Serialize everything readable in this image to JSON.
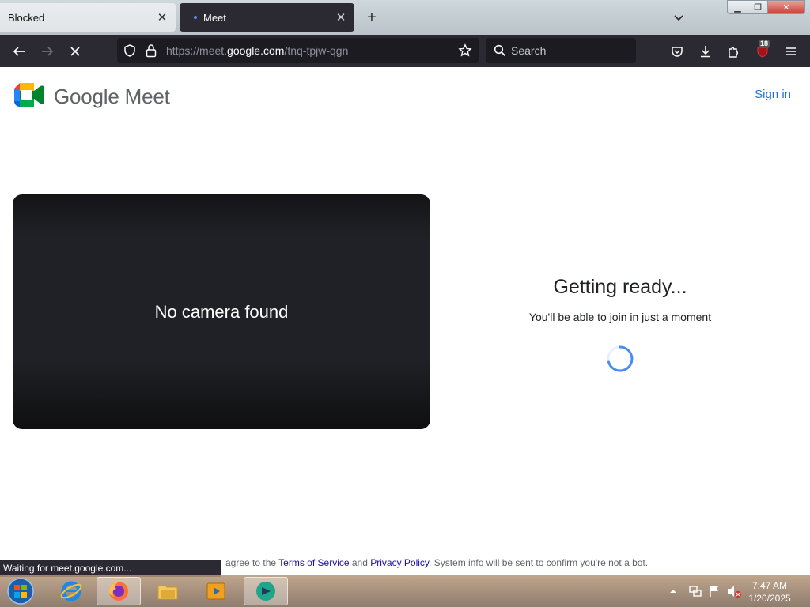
{
  "browser": {
    "tabs": [
      {
        "label": "Blocked",
        "active": false
      },
      {
        "label": "Meet",
        "active": true
      }
    ],
    "url": {
      "scheme": "https://",
      "host_prefix": "meet.",
      "host": "google.com",
      "path": "/tnq-tpjw-qgn"
    },
    "search_placeholder": "Search",
    "extension_badge": "18",
    "status": "Waiting for meet.google.com..."
  },
  "page": {
    "brand": "Google Meet",
    "sign_in": "Sign in",
    "preview_message": "No camera found",
    "ready_title": "Getting ready...",
    "ready_subtitle": "You'll be able to join in just a moment",
    "footer": {
      "prefix": " agree to the ",
      "terms": "Terms of Service",
      "middle": " and ",
      "privacy": "Privacy Policy",
      "suffix": ". System info will be sent to confirm you're not a bot."
    }
  },
  "taskbar": {
    "time": "7:47 AM",
    "date": "1/20/2025",
    "apps": [
      "internet-explorer",
      "firefox",
      "file-explorer",
      "media-player",
      "teamviewer"
    ]
  },
  "colors": {
    "browser_chrome": "#2b2a33",
    "link_blue": "#1a73e8",
    "preview_bg": "#202126"
  }
}
